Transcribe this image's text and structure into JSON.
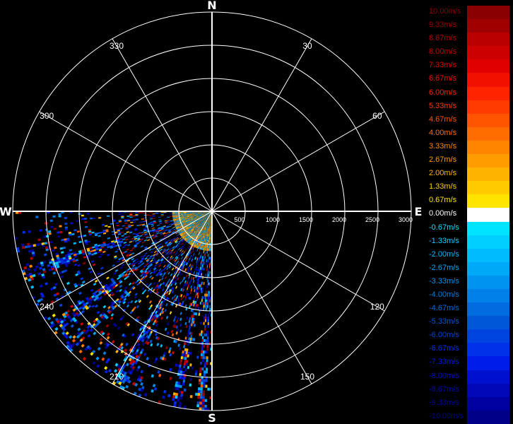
{
  "chart_data": {
    "type": "polar-radar",
    "cardinals": [
      "N",
      "E",
      "S",
      "W"
    ],
    "angle_labels": [
      30,
      60,
      120,
      150,
      210,
      240,
      300,
      330
    ],
    "range_labels": [
      "500",
      "1000",
      "1500",
      "2000",
      "2500",
      "3000"
    ],
    "range_rings": [
      500,
      1000,
      1500,
      2000,
      2500,
      3000
    ],
    "max_range": 3000,
    "legend": [
      {
        "label": "10.00m/s",
        "value": 10.0,
        "color": "#8a0000"
      },
      {
        "label": "9.33m/s",
        "value": 9.33,
        "color": "#a00000"
      },
      {
        "label": "8.67m/s",
        "value": 8.67,
        "color": "#b80000"
      },
      {
        "label": "8.00m/s",
        "value": 8.0,
        "color": "#cc0000"
      },
      {
        "label": "7.33m/s",
        "value": 7.33,
        "color": "#e00000"
      },
      {
        "label": "6.67m/s",
        "value": 6.67,
        "color": "#f21000"
      },
      {
        "label": "6.00m/s",
        "value": 6.0,
        "color": "#ff2400"
      },
      {
        "label": "5.33m/s",
        "value": 5.33,
        "color": "#ff3c00"
      },
      {
        "label": "4.67m/s",
        "value": 4.67,
        "color": "#ff5400"
      },
      {
        "label": "4.00m/s",
        "value": 4.0,
        "color": "#ff6c00"
      },
      {
        "label": "3.33m/s",
        "value": 3.33,
        "color": "#ff8400"
      },
      {
        "label": "2.67m/s",
        "value": 2.67,
        "color": "#ff9c00"
      },
      {
        "label": "2.00m/s",
        "value": 2.0,
        "color": "#ffb400"
      },
      {
        "label": "1.33m/s",
        "value": 1.33,
        "color": "#ffcc00"
      },
      {
        "label": "0.67m/s",
        "value": 0.67,
        "color": "#ffe400"
      },
      {
        "label": "0.00m/s",
        "value": 0.0,
        "color": "#ffffff"
      },
      {
        "label": "-0.67m/s",
        "value": -0.67,
        "color": "#00e4ff"
      },
      {
        "label": "-1.33m/s",
        "value": -1.33,
        "color": "#00d0ff"
      },
      {
        "label": "-2.00m/s",
        "value": -2.0,
        "color": "#00bcff"
      },
      {
        "label": "-2.67m/s",
        "value": -2.67,
        "color": "#00a8f8"
      },
      {
        "label": "-3.33m/s",
        "value": -3.33,
        "color": "#0094f0"
      },
      {
        "label": "-4.00m/s",
        "value": -4.0,
        "color": "#0080e8"
      },
      {
        "label": "-4.67m/s",
        "value": -4.67,
        "color": "#006ce0"
      },
      {
        "label": "-5.33m/s",
        "value": -5.33,
        "color": "#0058d8"
      },
      {
        "label": "-6.00m/s",
        "value": -6.0,
        "color": "#0044e0"
      },
      {
        "label": "-6.67m/s",
        "value": -6.67,
        "color": "#0030e8"
      },
      {
        "label": "-7.33m/s",
        "value": -7.33,
        "color": "#001ce8"
      },
      {
        "label": "-8.00m/s",
        "value": -8.0,
        "color": "#0010d0"
      },
      {
        "label": "-8.67m/s",
        "value": -8.67,
        "color": "#0008b8"
      },
      {
        "label": "-9.33m/s",
        "value": -9.33,
        "color": "#0000a0"
      },
      {
        "label": "-10.00m/s",
        "value": -10.0,
        "color": "#000088"
      }
    ],
    "coverage": {
      "azimuth_start": 180,
      "azimuth_end": 270,
      "range_max": 3000
    },
    "grid": true
  }
}
